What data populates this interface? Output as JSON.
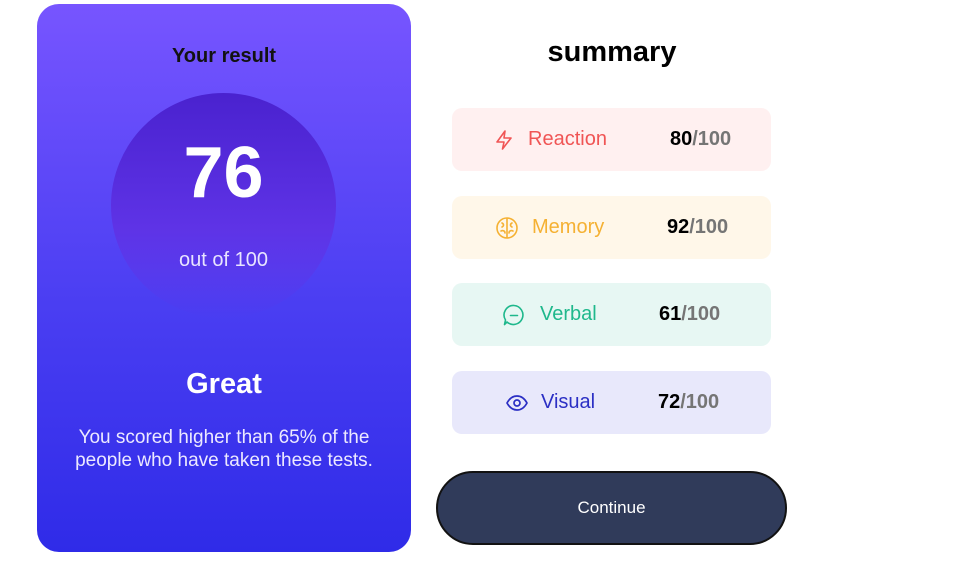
{
  "result": {
    "title": "Your result",
    "score": "76",
    "score_sub": "out of 100",
    "grade": "Great",
    "description": "You scored higher than 65% of the people who have taken these tests."
  },
  "summary": {
    "title": "summary",
    "items": [
      {
        "label": "Reaction",
        "score": "80",
        "total": "/100",
        "icon": "lightning-icon",
        "color": "#f05555"
      },
      {
        "label": "Memory",
        "score": "92",
        "total": "/100",
        "icon": "brain-icon",
        "color": "#f5b133"
      },
      {
        "label": "Verbal",
        "score": "61",
        "total": "/100",
        "icon": "chat-bubble-icon",
        "color": "#1fb88c"
      },
      {
        "label": "Visual",
        "score": "72",
        "total": "/100",
        "icon": "eye-icon",
        "color": "#2b2fc4"
      }
    ]
  },
  "actions": {
    "continue_label": "Continue"
  },
  "colors": {
    "card_gradient_top": "#7755ff",
    "card_gradient_bottom": "#2f2be8",
    "button_bg": "#303b5a"
  }
}
